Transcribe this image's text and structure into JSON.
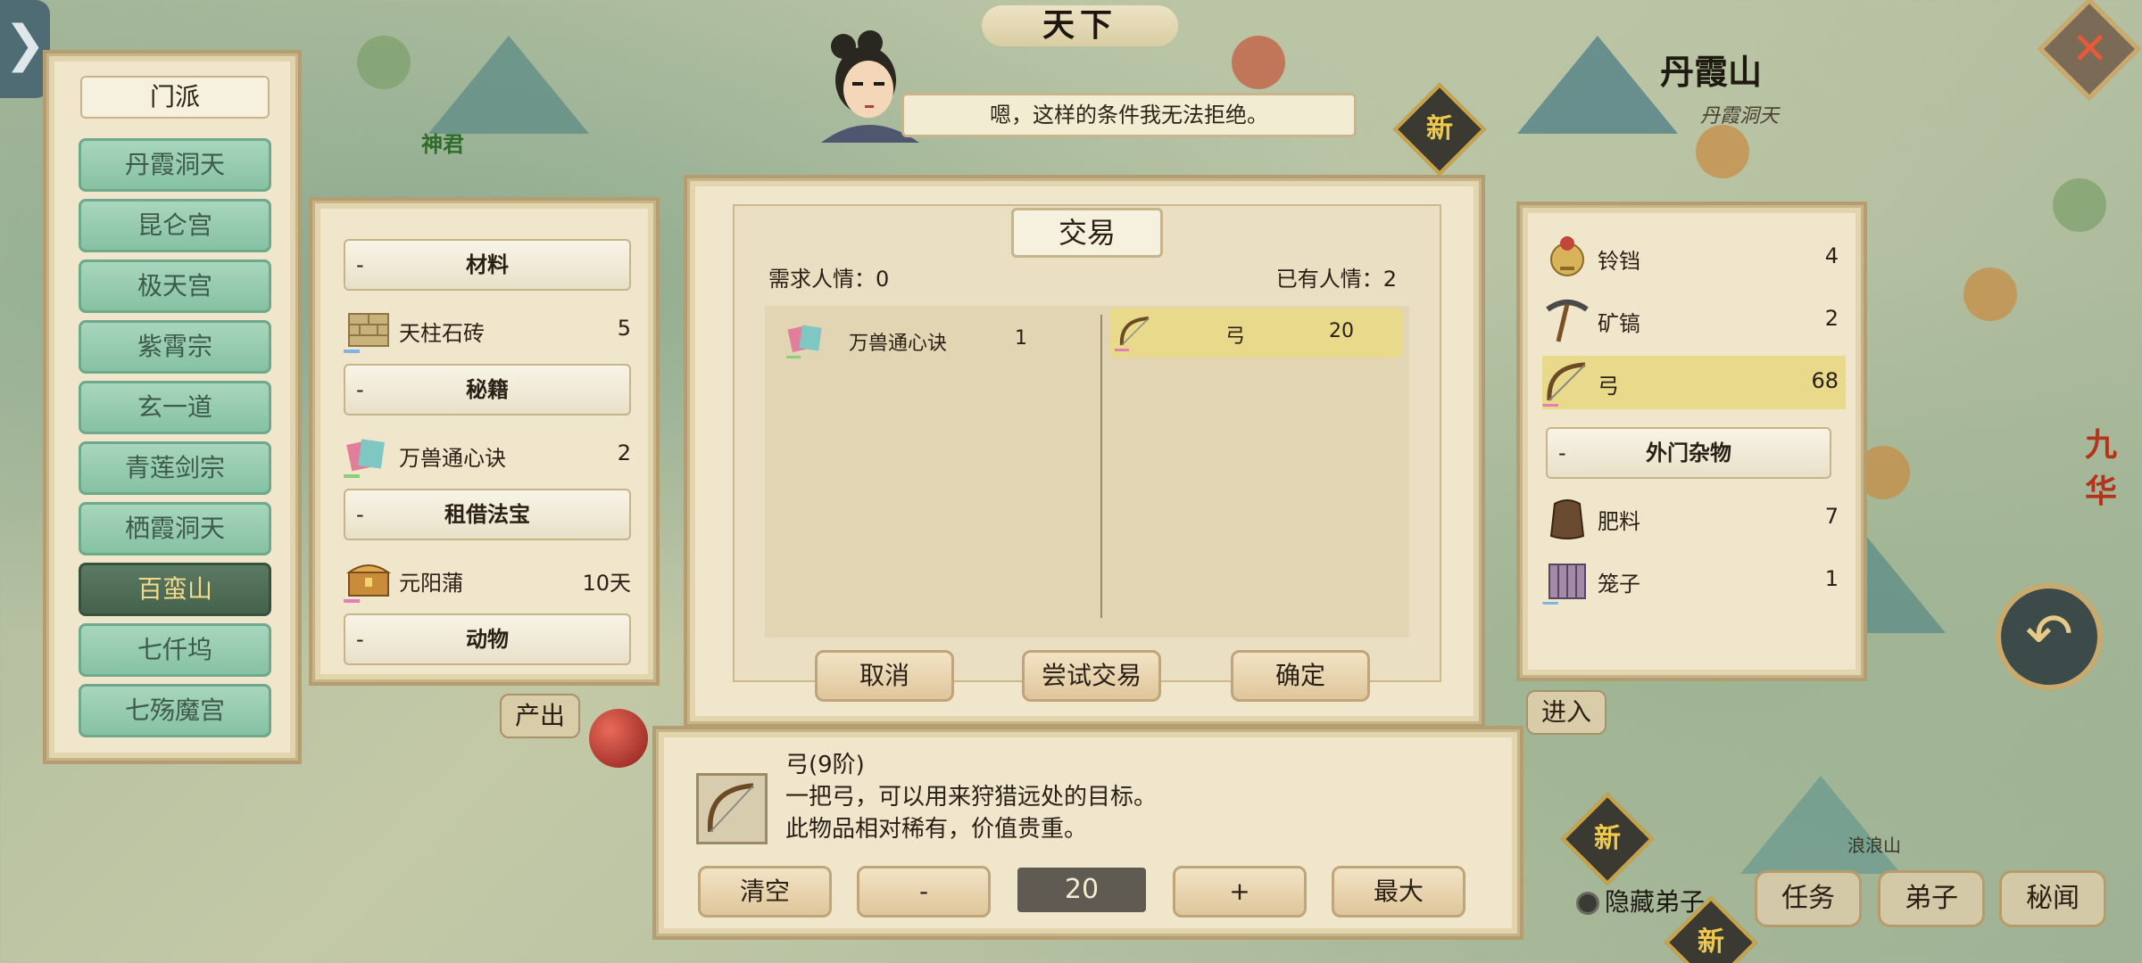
{
  "world_title": "天下",
  "npc": {
    "dialog": "嗯，这样的条件我无法拒绝。"
  },
  "map_labels": {
    "danxia_mountain": "丹霞山",
    "danxia_sub": "丹霞洞天",
    "shenjun": "神君",
    "langlang": "浪浪山",
    "jiuhua": "九华",
    "new1": "新",
    "new2": "新",
    "new3": "新",
    "output": "产出",
    "enter": "进入"
  },
  "sect_panel": {
    "header": "门派",
    "items": [
      {
        "label": "丹霞洞天"
      },
      {
        "label": "昆仑宫"
      },
      {
        "label": "极天宫"
      },
      {
        "label": "紫霄宗"
      },
      {
        "label": "玄一道"
      },
      {
        "label": "青莲剑宗"
      },
      {
        "label": "栖霞洞天"
      },
      {
        "label": "百蛮山"
      },
      {
        "label": "七仟坞"
      },
      {
        "label": "七殇魔宫"
      }
    ],
    "active_index": 7
  },
  "left_inventory": {
    "categories": [
      {
        "dash": "-",
        "title": "材料"
      },
      {
        "dash": "-",
        "title": "秘籍"
      },
      {
        "dash": "-",
        "title": "租借法宝"
      },
      {
        "dash": "-",
        "title": "动物"
      }
    ],
    "items": [
      {
        "name": "天柱石砖",
        "qty": "5",
        "icon": "stone-brick-icon"
      },
      {
        "name": "万兽通心诀",
        "qty": "2",
        "icon": "scroll-book-icon"
      },
      {
        "name": "元阳蒲",
        "qty": "10天",
        "icon": "treasure-chest-icon"
      }
    ]
  },
  "trade": {
    "title": "交易",
    "need_label": "需求人情：0",
    "have_label": "已有人情：2",
    "offer": {
      "name": "万兽通心诀",
      "qty": "1"
    },
    "request": {
      "name": "弓",
      "qty": "20"
    },
    "buttons": {
      "cancel": "取消",
      "try": "尝试交易",
      "confirm": "确定"
    }
  },
  "right_inventory": {
    "items": [
      {
        "name": "铃铛",
        "qty": "4",
        "icon": "bell-icon"
      },
      {
        "name": "矿镐",
        "qty": "2",
        "icon": "pickaxe-icon"
      },
      {
        "name": "弓",
        "qty": "68",
        "icon": "bow-icon"
      }
    ],
    "category": {
      "dash": "-",
      "title": "外门杂物"
    },
    "items2": [
      {
        "name": "肥料",
        "qty": "7",
        "icon": "fertilizer-sack-icon"
      },
      {
        "name": "笼子",
        "qty": "1",
        "icon": "cage-icon"
      }
    ]
  },
  "detail": {
    "title": "弓(9阶)",
    "line1": "一把弓，可以用来狩猎远处的目标。",
    "line2": "此物品相对稀有，价值贵重。",
    "quantity": "20",
    "buttons": {
      "clear": "清空",
      "minus": "-",
      "plus": "+",
      "max": "最大"
    }
  },
  "bottom_bar": {
    "hide_disciple": "隐藏弟子",
    "task": "任务",
    "disciple": "弟子",
    "secrets": "秘闻"
  },
  "colors": {
    "sect_green": "#86c1a3",
    "sect_active": "#45624c",
    "selected_row": "#e8da8a",
    "parchment": "#efe6cc"
  }
}
